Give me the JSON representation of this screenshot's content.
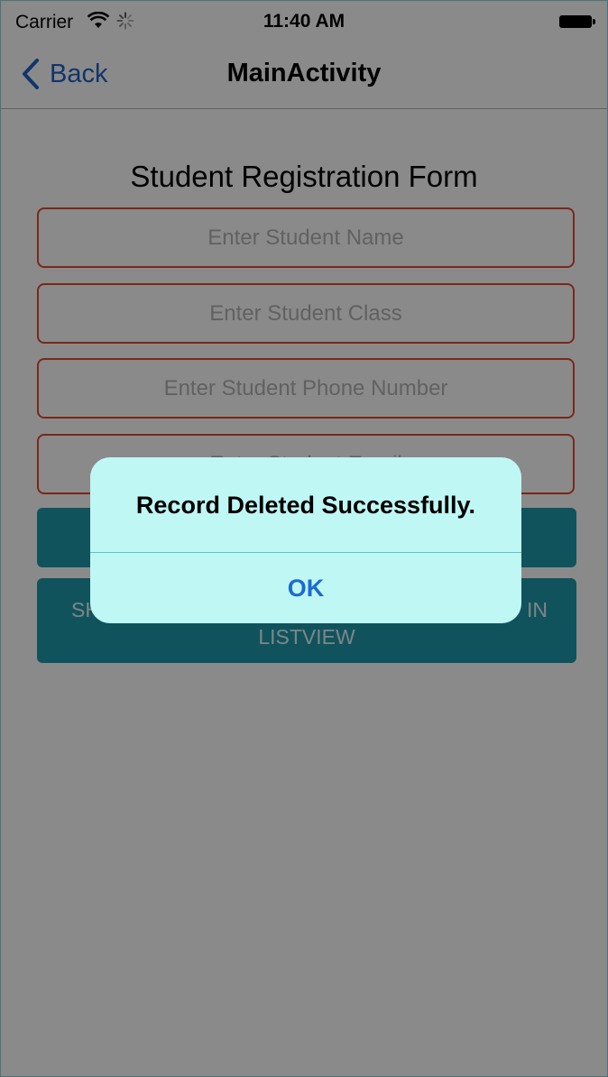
{
  "status_bar": {
    "carrier": "Carrier",
    "time": "11:40 AM",
    "icons": [
      "wifi-icon",
      "activity-spinner-icon",
      "battery-icon"
    ]
  },
  "nav": {
    "back_label": "Back",
    "title": "MainActivity",
    "icons": [
      "chevron-left-icon"
    ]
  },
  "form": {
    "title": "Student Registration Form",
    "fields": [
      {
        "placeholder": "Enter Student Name",
        "value": ""
      },
      {
        "placeholder": "Enter Student Class",
        "value": ""
      },
      {
        "placeholder": "Enter Student Phone Number",
        "value": ""
      },
      {
        "placeholder": "Enter Student Email",
        "value": ""
      }
    ],
    "buttons": {
      "show_line1_left": "SH",
      "show_line1_right": "IN",
      "show_line2": "LISTVIEW"
    }
  },
  "alert": {
    "message": "Record Deleted Successfully.",
    "ok_label": "OK"
  },
  "colors": {
    "accent_text": "#1e63c6",
    "field_border": "#e24a2e",
    "button_bg": "#1e9aac",
    "alert_bg": "#bff7f4"
  }
}
